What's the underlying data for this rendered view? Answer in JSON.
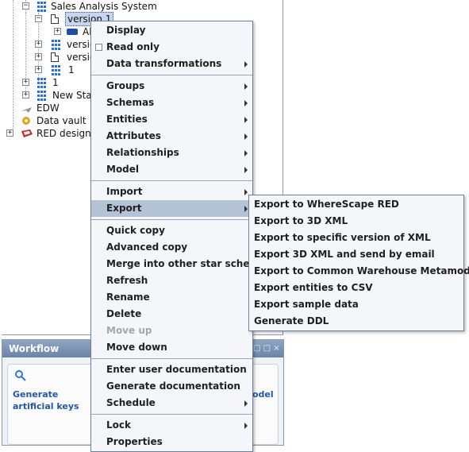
{
  "tree": {
    "items": [
      {
        "label": "Sales Analysis System"
      },
      {
        "label": "version 1"
      },
      {
        "label": "Al"
      },
      {
        "label": "versio"
      },
      {
        "label": "versio"
      },
      {
        "label": "1"
      },
      {
        "label": "1"
      },
      {
        "label": "New Star"
      },
      {
        "label": "EDW"
      },
      {
        "label": "Data vault"
      },
      {
        "label": "RED design"
      }
    ]
  },
  "workflow": {
    "title": "Workflow",
    "controls": "□ □ ×",
    "card1_line1": "Generate",
    "card1_line2": "artificial keys",
    "card2_text": "odel"
  },
  "context_menu": {
    "items": [
      {
        "label": "Display"
      },
      {
        "label": "Read only"
      },
      {
        "label": "Data transformations"
      },
      {
        "label": "Groups"
      },
      {
        "label": "Schemas"
      },
      {
        "label": "Entities"
      },
      {
        "label": "Attributes"
      },
      {
        "label": "Relationships"
      },
      {
        "label": "Model"
      },
      {
        "label": "Import"
      },
      {
        "label": "Export"
      },
      {
        "label": "Quick copy"
      },
      {
        "label": "Advanced copy"
      },
      {
        "label": "Merge into other star schema"
      },
      {
        "label": "Refresh"
      },
      {
        "label": "Rename"
      },
      {
        "label": "Delete"
      },
      {
        "label": "Move up"
      },
      {
        "label": "Move down"
      },
      {
        "label": "Enter user documentation"
      },
      {
        "label": "Generate documentation"
      },
      {
        "label": "Schedule"
      },
      {
        "label": "Lock"
      },
      {
        "label": "Properties"
      }
    ]
  },
  "export_submenu": {
    "items": [
      {
        "label": "Export to WhereScape RED"
      },
      {
        "label": "Export to 3D XML"
      },
      {
        "label": "Export to specific version of XML"
      },
      {
        "label": "Export 3D XML and send by email"
      },
      {
        "label": "Export to Common Warehouse Metamodel"
      },
      {
        "label": "Export entities to CSV"
      },
      {
        "label": "Export sample data"
      },
      {
        "label": "Generate DDL"
      }
    ]
  },
  "colors": {
    "accent": "#2257a8",
    "menu_highlight": "#b4c2d6",
    "grid_icon": "#2a6fd6"
  }
}
